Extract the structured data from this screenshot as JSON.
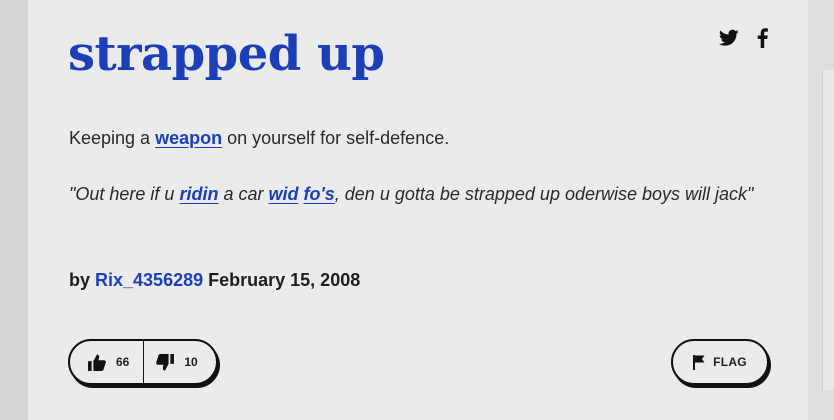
{
  "definition": {
    "word": "strapped up",
    "meaning": {
      "before": "Keeping a ",
      "link": "weapon",
      "after": " on yourself for self-defence."
    },
    "example": {
      "quote_open": "\"Out here if u ",
      "link1": "ridin",
      "text1": " a car ",
      "link2": "wid",
      "text2": " ",
      "link3": "fo's",
      "text3": ", den u gotta be strapped up oderwise boys will jack\""
    },
    "contributor": {
      "by": "by ",
      "author": "Rix_4356289",
      "date": " February 15, 2008"
    }
  },
  "share": {
    "twitter_icon": "twitter-icon",
    "facebook_icon": "facebook-icon"
  },
  "votes": {
    "up_count": "66",
    "down_count": "10"
  },
  "flag": {
    "label": "FLAG"
  },
  "colors": {
    "accent": "#1c3fb8",
    "card_background": "#ebebeb",
    "text": "#2a2a2a"
  }
}
